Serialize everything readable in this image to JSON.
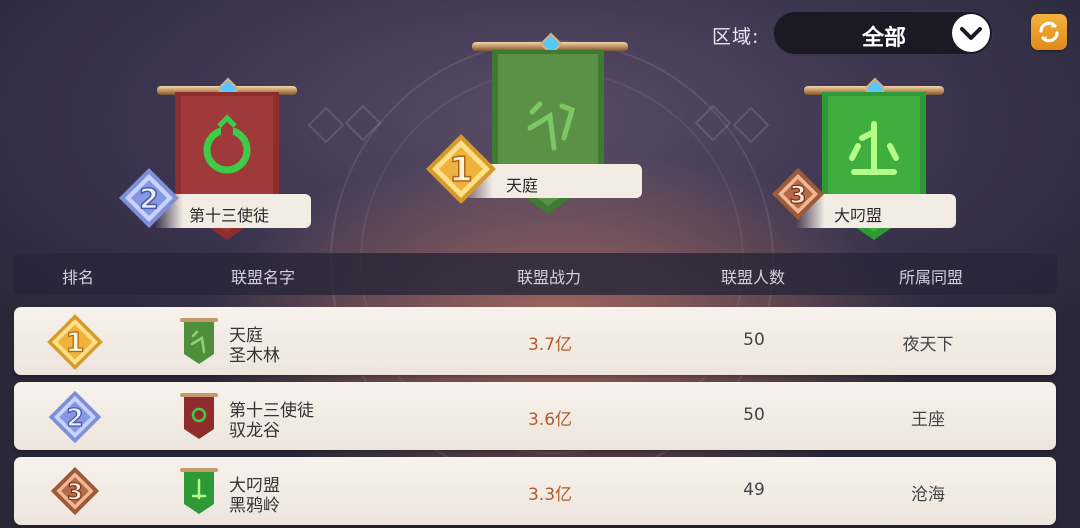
{
  "filter": {
    "region_label": "区域:",
    "region_value": "全部"
  },
  "podium": [
    {
      "rank": "1",
      "name": "天庭",
      "flag_color": "#4f8f3c"
    },
    {
      "rank": "2",
      "name": "第十三使徒",
      "flag_color": "#8f2c2c"
    },
    {
      "rank": "3",
      "name": "大叼盟",
      "flag_color": "#2f9a35"
    }
  ],
  "table": {
    "headers": [
      "排名",
      "联盟名字",
      "联盟战力",
      "联盟人数",
      "所属同盟"
    ],
    "rows": [
      {
        "rank": "1",
        "name": "天庭",
        "sub": "圣木林",
        "power": "3.7亿",
        "members": "50",
        "alliance": "夜天下",
        "flag_color": "#4f8f3c",
        "medal": "gold"
      },
      {
        "rank": "2",
        "name": "第十三使徒",
        "sub": "驭龙谷",
        "power": "3.6亿",
        "members": "50",
        "alliance": "王座",
        "flag_color": "#8f2c2c",
        "medal": "silver"
      },
      {
        "rank": "3",
        "name": "大叼盟",
        "sub": "黑鸦岭",
        "power": "3.3亿",
        "members": "49",
        "alliance": "沧海",
        "flag_color": "#2f9a35",
        "medal": "bronze"
      }
    ]
  },
  "icons": {
    "dropdown": "chevron-down-icon",
    "refresh": "refresh-icon"
  }
}
